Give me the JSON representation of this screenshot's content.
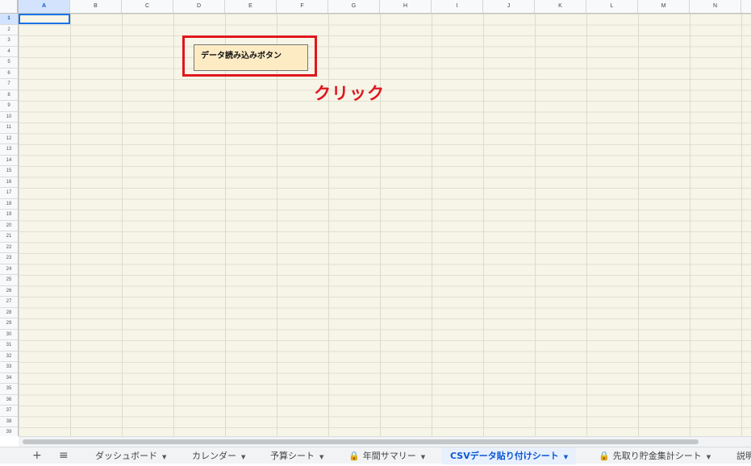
{
  "columns": [
    "A",
    "B",
    "C",
    "D",
    "E",
    "F",
    "G",
    "H",
    "I",
    "J",
    "K",
    "L",
    "M",
    "N"
  ],
  "selected_column": "A",
  "rows": [
    "1",
    "2",
    "3",
    "4",
    "5",
    "6",
    "7",
    "8",
    "9",
    "10",
    "11",
    "12",
    "13",
    "14",
    "15",
    "16",
    "17",
    "18",
    "19",
    "20",
    "21",
    "22",
    "23",
    "24",
    "25",
    "26",
    "27",
    "28",
    "29",
    "30",
    "31",
    "32",
    "33",
    "34",
    "35",
    "36",
    "37",
    "38",
    "39"
  ],
  "selected_row": "1",
  "button": {
    "label": "データ読み込みボタン"
  },
  "annotation": {
    "text": "クリック",
    "color": "#e0161e"
  },
  "toolbar": {
    "add_icon": "plus-icon",
    "add_glyph": "+",
    "list_icon": "hamburger-menu-icon",
    "list_glyph": "≡"
  },
  "tabs": [
    {
      "label": "ダッシュボード",
      "locked": false,
      "active": false
    },
    {
      "label": "カレンダー",
      "locked": false,
      "active": false
    },
    {
      "label": "予算シート",
      "locked": false,
      "active": false
    },
    {
      "label": "年間サマリー",
      "locked": true,
      "active": false
    },
    {
      "label": "CSVデータ貼り付けシート",
      "locked": false,
      "active": true
    },
    {
      "label": "先取り貯金集計シート",
      "locked": true,
      "active": false
    },
    {
      "label": "説明",
      "locked": false,
      "active": false
    }
  ],
  "colors": {
    "accent": "#0b57d0",
    "button_bg": "#fdebc4",
    "highlight": "#e0161e"
  }
}
